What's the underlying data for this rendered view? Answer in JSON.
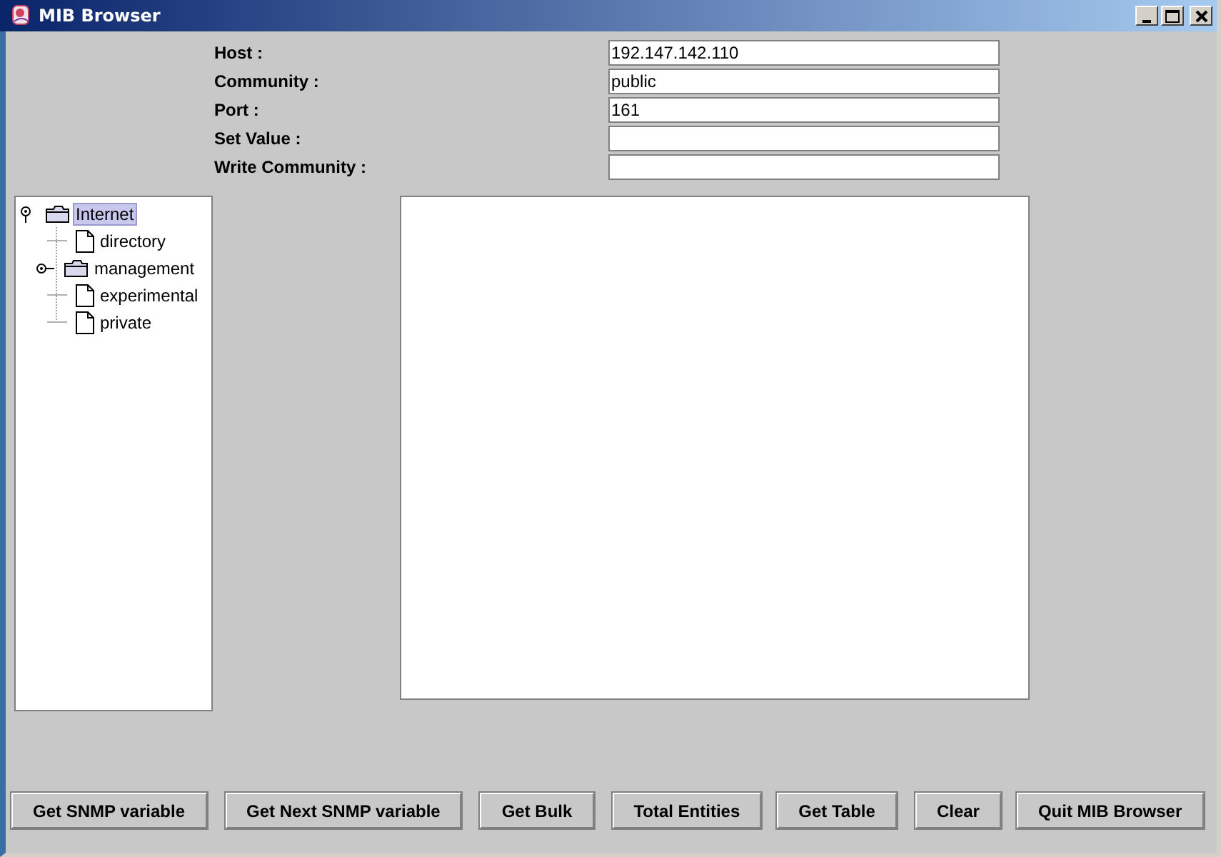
{
  "window": {
    "title": "MIB Browser"
  },
  "form": [
    {
      "label": "Host :",
      "value": "192.147.142.110"
    },
    {
      "label": "Community :",
      "value": "public"
    },
    {
      "label": "Port :",
      "value": "161"
    },
    {
      "label": "Set Value :"
    },
    {
      "label": "Write Community :"
    }
  ],
  "tree": [
    {
      "label": "Internet",
      "kind": "folder",
      "expanded": true,
      "selected": true,
      "children": [
        {
          "label": "directory",
          "kind": "leaf",
          "selected": false
        },
        {
          "label": "management",
          "kind": "folder",
          "expanded": false,
          "selected": false
        },
        {
          "label": "experimental",
          "kind": "leaf",
          "selected": false
        },
        {
          "label": "private",
          "kind": "leaf",
          "selected": false
        }
      ]
    }
  ],
  "buttons": [
    "Get SNMP variable",
    "Get Next SNMP variable",
    "Get Bulk",
    "Total Entities",
    "Get Table",
    "Clear",
    "Quit MIB Browser"
  ]
}
